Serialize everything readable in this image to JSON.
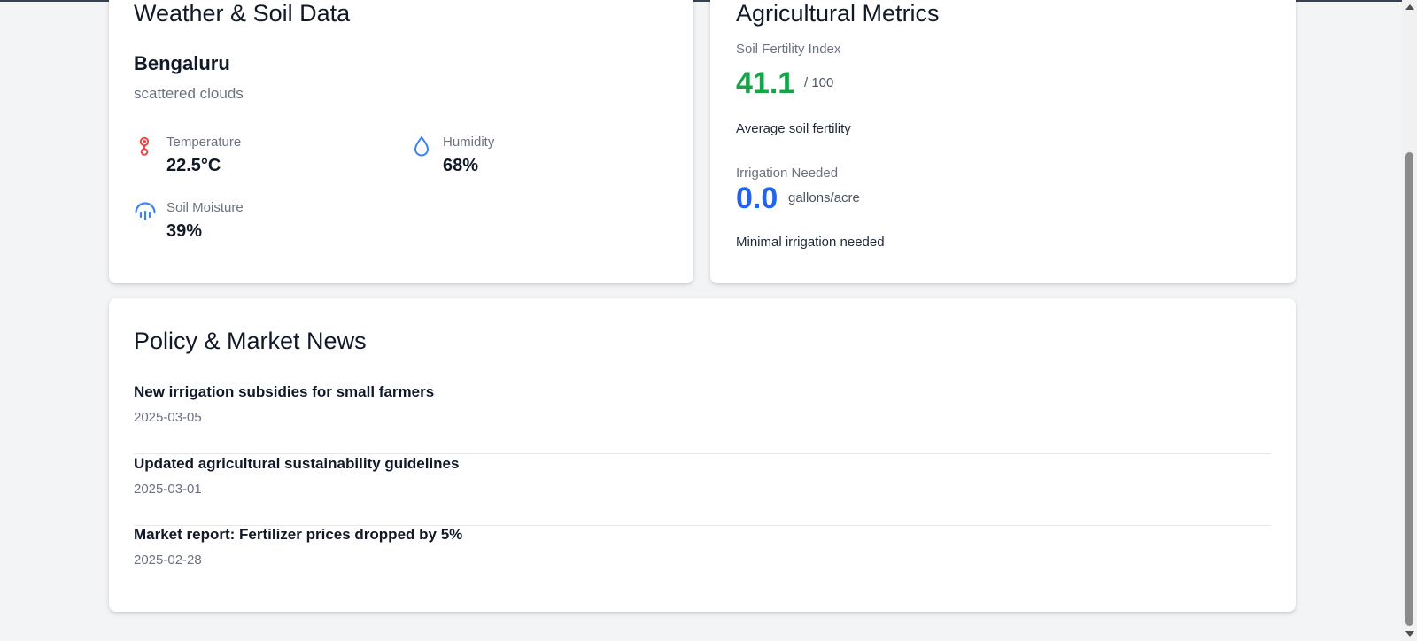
{
  "weather": {
    "title": "Weather & Soil Data",
    "city": "Bengaluru",
    "condition": "scattered clouds",
    "temperature": {
      "label": "Temperature",
      "value": "22.5°C",
      "icon": "thermometer-icon"
    },
    "humidity": {
      "label": "Humidity",
      "value": "68%",
      "icon": "droplet-icon"
    },
    "soil_moisture": {
      "label": "Soil Moisture",
      "value": "39%",
      "icon": "umbrella-icon"
    }
  },
  "metrics": {
    "title": "Agricultural Metrics",
    "fertility": {
      "label": "Soil Fertility Index",
      "value": "41.1",
      "unit": "/ 100",
      "description": "Average soil fertility",
      "color": "#16a34a"
    },
    "irrigation": {
      "label": "Irrigation Needed",
      "value": "0.0",
      "unit": "gallons/acre",
      "description": "Minimal irrigation needed",
      "color": "#2563eb"
    }
  },
  "news": {
    "title": "Policy & Market News",
    "items": [
      {
        "title": "New irrigation subsidies for small farmers",
        "date": "2025-03-05"
      },
      {
        "title": "Updated agricultural sustainability guidelines",
        "date": "2025-03-01"
      },
      {
        "title": "Market report: Fertilizer prices dropped by 5%",
        "date": "2025-02-28"
      }
    ]
  },
  "colors": {
    "temperature_icon": "#ef4444",
    "humidity_icon": "#3b82f6",
    "soil_icon": "#3b82f6"
  }
}
